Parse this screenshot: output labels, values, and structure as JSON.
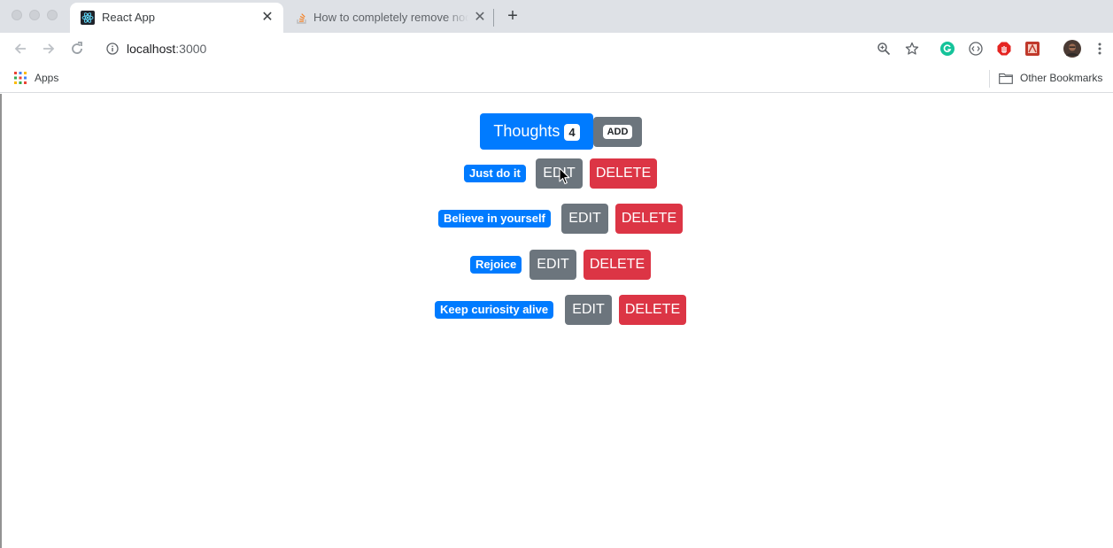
{
  "browser": {
    "tabs": [
      {
        "title": "React App",
        "icon": "react-icon"
      },
      {
        "title": "How to completely remove node",
        "icon": "stackoverflow-icon"
      }
    ],
    "close_glyph": "✕",
    "new_tab_glyph": "+",
    "url": {
      "host": "localhost",
      "port": ":3000"
    },
    "bookmarks": {
      "apps_label": "Apps",
      "other_label": "Other Bookmarks"
    }
  },
  "app": {
    "header": {
      "title": "Thoughts",
      "count": "4",
      "add_label": "ADD"
    },
    "thoughts": [
      {
        "text": "Just do it",
        "edit_label": "EDIT",
        "delete_label": "DELETE"
      },
      {
        "text": "Believe in yourself",
        "edit_label": "EDIT",
        "delete_label": "DELETE"
      },
      {
        "text": "Rejoice",
        "edit_label": "EDIT",
        "delete_label": "DELETE"
      },
      {
        "text": "Keep curiosity alive",
        "edit_label": "EDIT",
        "delete_label": "DELETE"
      }
    ]
  },
  "colors": {
    "primary": "#007bff",
    "secondary": "#6c757d",
    "danger": "#dc3545"
  }
}
